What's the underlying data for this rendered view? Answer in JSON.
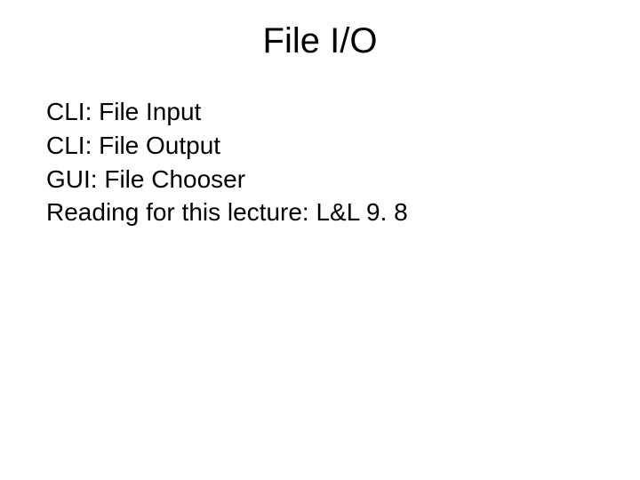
{
  "slide": {
    "title": "File I/O",
    "lines": [
      "CLI: File Input",
      "CLI: File Output",
      "GUI: File Chooser",
      "Reading for this lecture: L&L 9. 8"
    ]
  }
}
